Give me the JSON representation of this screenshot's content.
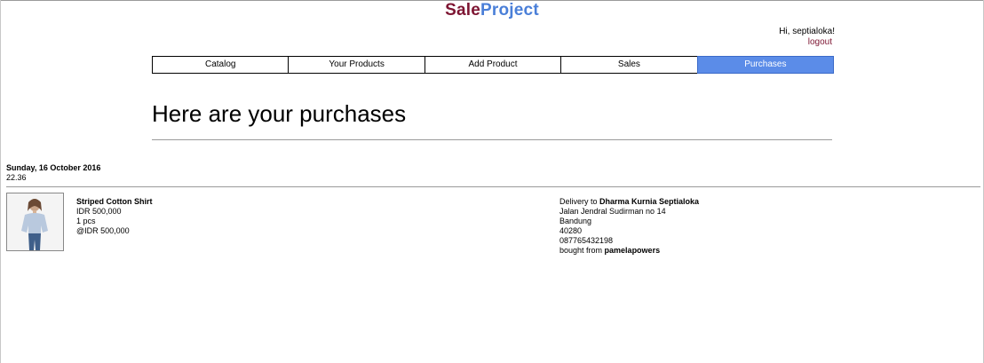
{
  "header": {
    "logo_part1": "Sale",
    "logo_part2": "Project"
  },
  "user": {
    "greeting": "Hi, septialoka!",
    "logout_label": "logout"
  },
  "nav": {
    "tabs": [
      {
        "label": "Catalog"
      },
      {
        "label": "Your Products"
      },
      {
        "label": "Add Product"
      },
      {
        "label": "Sales"
      },
      {
        "label": "Purchases",
        "active": true
      }
    ]
  },
  "page": {
    "title": "Here are your purchases"
  },
  "purchases": [
    {
      "date": "Sunday, 16 October 2016",
      "time": "22.36",
      "product": {
        "name": "Striped Cotton Shirt",
        "total": "IDR 500,000",
        "quantity": "1 pcs",
        "unit_price": "@IDR 500,000"
      },
      "delivery": {
        "prefix": "Delivery to",
        "recipient": "Dharma Kurnia Septialoka",
        "address": "Jalan Jendral Sudirman no 14",
        "city": "Bandung",
        "postal_code": "40280",
        "phone": "087765432198",
        "seller_prefix": "bought from",
        "seller": "pamelapowers"
      }
    }
  ],
  "colors": {
    "brand_dark": "#7d1532",
    "brand_blue": "#4a7fd8",
    "active_tab": "#5b8ce8"
  }
}
